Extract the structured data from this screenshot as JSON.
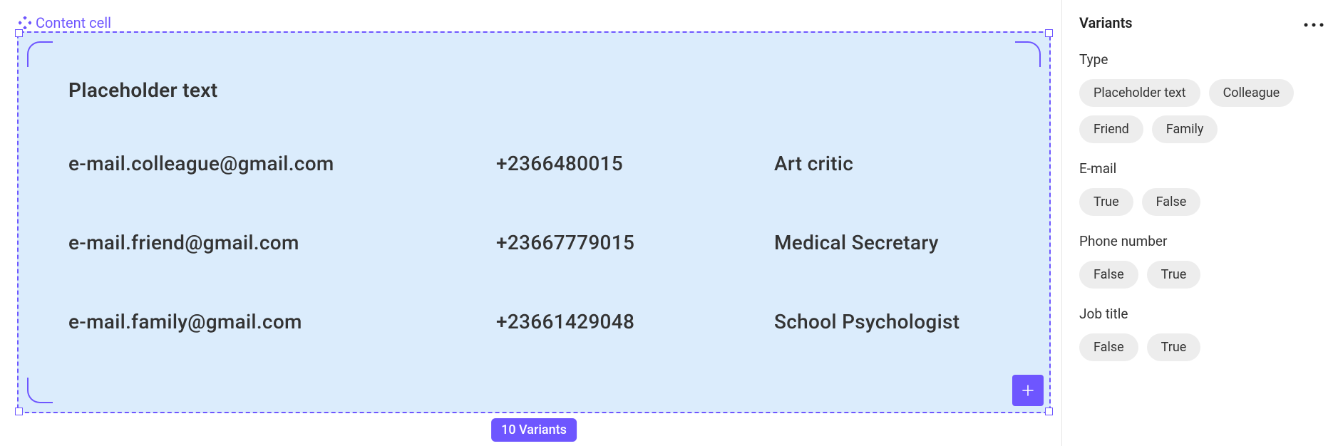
{
  "component": {
    "name": "Content cell",
    "variants_badge": "10 Variants",
    "header_label": "Placeholder text",
    "rows": [
      {
        "email": "e-mail.colleague@gmail.com",
        "phone": "+2366480015",
        "job": "Art critic"
      },
      {
        "email": "e-mail.friend@gmail.com",
        "phone": "+23667779015",
        "job": "Medical Secretary"
      },
      {
        "email": "e-mail.family@gmail.com",
        "phone": "+23661429048",
        "job": "School Psychologist"
      }
    ]
  },
  "sidebar": {
    "title": "Variants",
    "props": [
      {
        "label": "Type",
        "options": [
          "Placeholder text",
          "Colleague",
          "Friend",
          "Family"
        ]
      },
      {
        "label": "E-mail",
        "options": [
          "True",
          "False"
        ]
      },
      {
        "label": "Phone number",
        "options": [
          "False",
          "True"
        ]
      },
      {
        "label": "Job title",
        "options": [
          "False",
          "True"
        ]
      }
    ]
  }
}
